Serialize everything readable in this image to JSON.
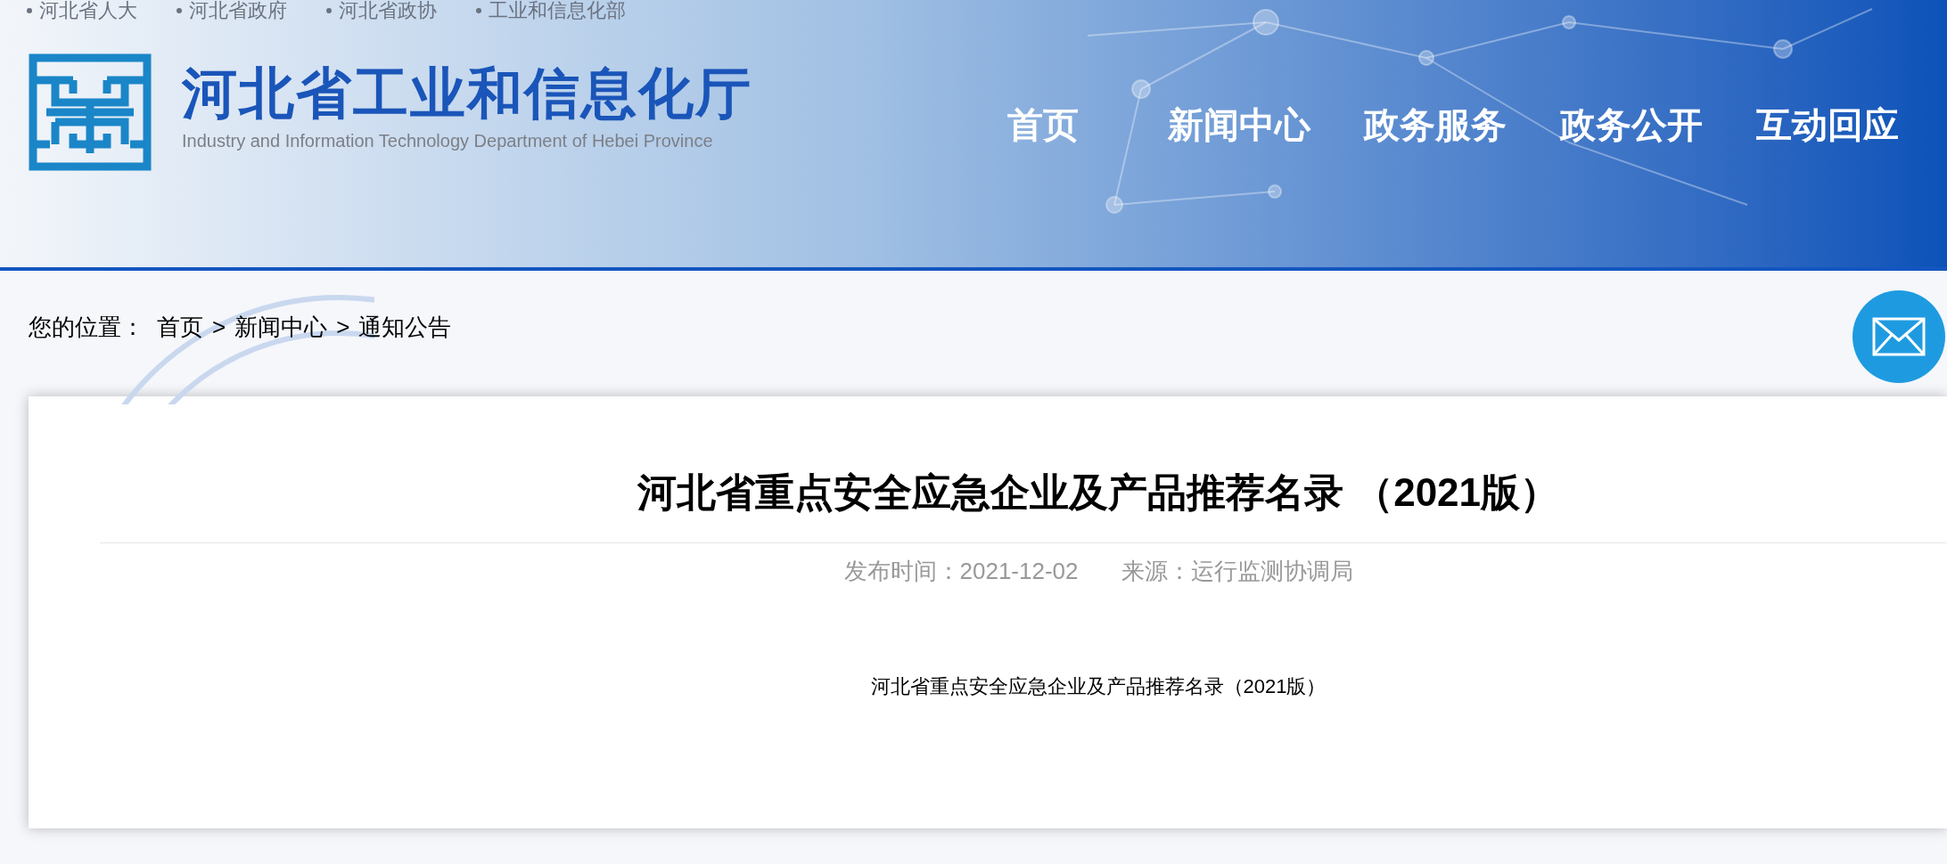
{
  "top_links": [
    "河北省人大",
    "河北省政府",
    "河北省政协",
    "工业和信息化部"
  ],
  "site": {
    "title": "河北省工业和信息化厅",
    "subtitle": "Industry and Information Technology Department of Hebei Province"
  },
  "nav": [
    {
      "label": "首页"
    },
    {
      "label": "新闻中心"
    },
    {
      "label": "政务服务"
    },
    {
      "label": "政务公开"
    },
    {
      "label": "互动回应"
    }
  ],
  "breadcrumb": {
    "label": "您的位置：",
    "separator": ">",
    "items": [
      "首页",
      "新闻中心",
      "通知公告"
    ]
  },
  "article": {
    "title": "河北省重点安全应急企业及产品推荐名录 （2021版）",
    "date": "发布时间：2021-12-02",
    "source": "来源：运行监测协调局",
    "body": "河北省重点安全应急企业及产品推荐名录（2021版）"
  }
}
